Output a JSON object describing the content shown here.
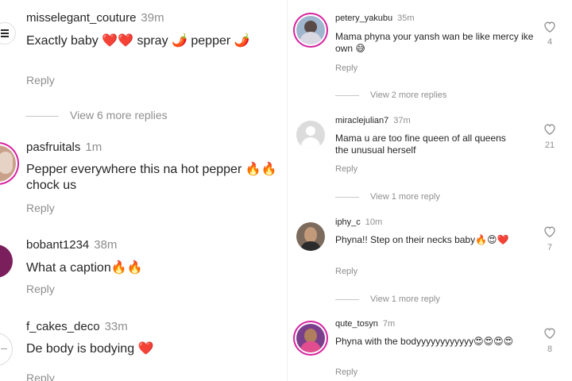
{
  "left": {
    "comments": [
      {
        "username": "misselegant_couture",
        "time": "39m",
        "text": "Exactly baby ❤️❤️ spray 🌶️ pepper 🌶️",
        "reply": "Reply"
      },
      {
        "username": "pasfruitals",
        "time": "1m",
        "text": "Pepper everywhere  this na hot pepper 🔥🔥 chock us",
        "reply": "Reply"
      },
      {
        "username": "bobant1234",
        "time": "38m",
        "text": "What a caption🔥🔥",
        "reply": "Reply"
      },
      {
        "username": "f_cakes_deco",
        "time": "33m",
        "text": "De body is bodying ❤️",
        "reply": "Reply"
      }
    ],
    "view_more": "View 6 more replies"
  },
  "right": {
    "comments": [
      {
        "username": "petery_yakubu",
        "time": "35m",
        "text": "Mama phyna your yansh wan be like mercy ike own 😅",
        "reply": "Reply",
        "likes": "4"
      },
      {
        "username": "miraclejulian7",
        "time": "37m",
        "text": "Mama u are too fine queen of all queens the unusual herself",
        "reply": "Reply",
        "likes": "21"
      },
      {
        "username": "iphy_c",
        "time": "10m",
        "text": "Phyna!! Step on their necks baby🔥😍❤️",
        "reply": "Reply",
        "likes": "7"
      },
      {
        "username": "qute_tosyn",
        "time": "7m",
        "text": "Phyna with the bodyyyyyyyyyyyy😍😍😍😍",
        "reply": "Reply",
        "likes": "8"
      }
    ],
    "view_more": [
      "View 2 more replies",
      "View 1 more reply",
      "View 1 more reply"
    ]
  },
  "colors": {
    "ring": "#d6249f",
    "muted": "#8e8e8e",
    "text": "#262626"
  }
}
